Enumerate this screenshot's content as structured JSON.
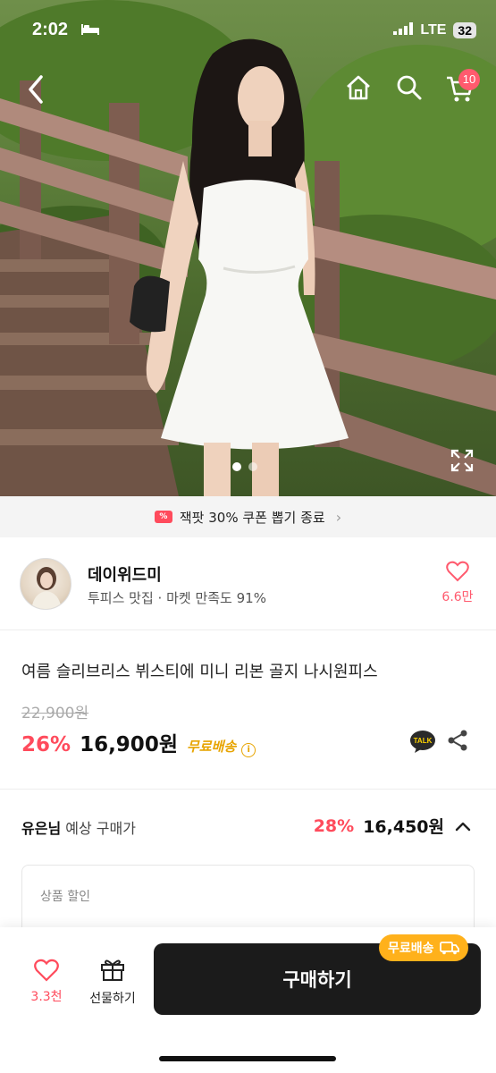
{
  "status_bar": {
    "time": "2:02",
    "network": "LTE",
    "battery": "32"
  },
  "nav": {
    "cart_count": "10"
  },
  "coupon_banner": {
    "text": "잭팟 30% 쿠폰 뽑기 종료"
  },
  "shop": {
    "name": "데이위드미",
    "subtitle": "투피스 맛집 · 마켓 만족도 91%",
    "likes": "6.6만"
  },
  "product": {
    "title": "여름 슬리브리스 뷔스티에 미니 리본 골지 나시원피스",
    "original_price": "22,900원",
    "discount": "26%",
    "price": "16,900원",
    "free_shipping": "무료배송"
  },
  "expected": {
    "user": "유은님",
    "label": "예상 구매가",
    "discount": "28%",
    "price": "16,450원",
    "box_label": "상품 할인"
  },
  "bottom_bar": {
    "likes": "3.3천",
    "gift_label": "선물하기",
    "buy_label": "구매하기",
    "ship_badge": "무료배송"
  },
  "colors": {
    "accent": "#ff4b5c",
    "shipping": "#ffb11b",
    "buy_button": "#1b1b1b"
  }
}
